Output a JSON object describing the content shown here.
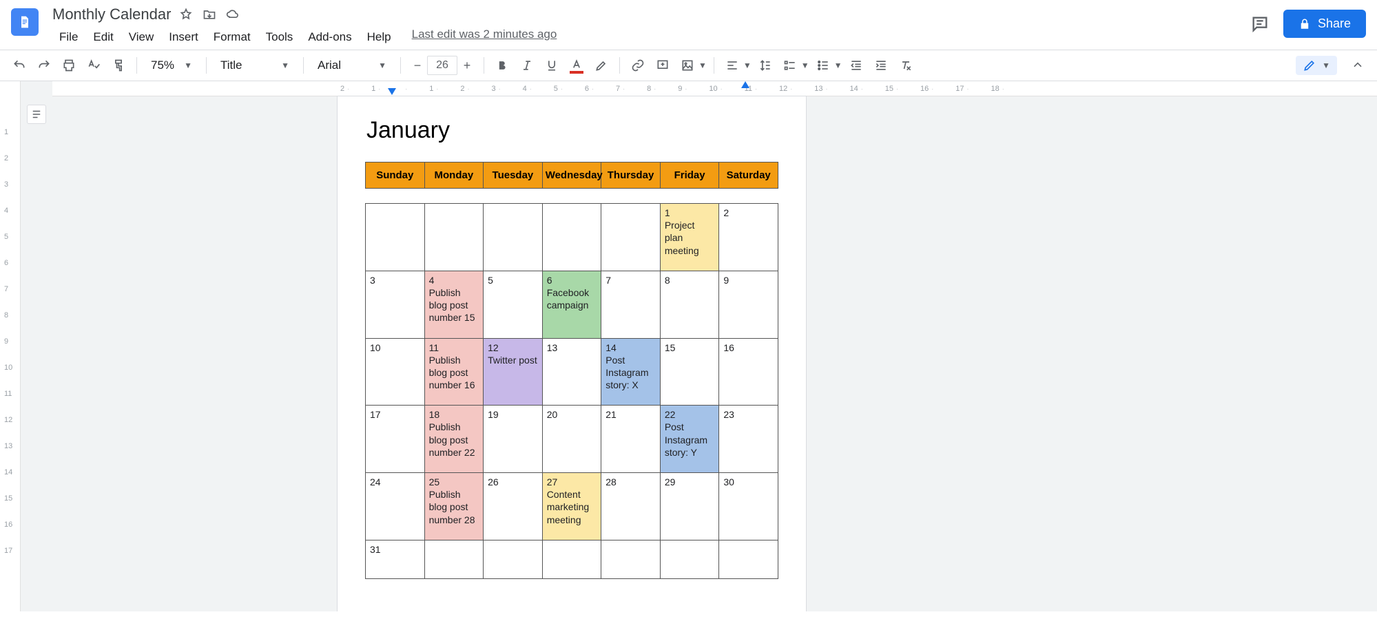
{
  "header": {
    "doc_title": "Monthly Calendar",
    "last_edit": "Last edit was 2 minutes ago",
    "share_label": "Share"
  },
  "menubar": [
    "File",
    "Edit",
    "View",
    "Insert",
    "Format",
    "Tools",
    "Add-ons",
    "Help"
  ],
  "toolbar": {
    "zoom": "75%",
    "styles": "Title",
    "font": "Arial",
    "font_size": "26"
  },
  "ruler": {
    "horizontal": [
      "2",
      "1",
      "",
      "1",
      "2",
      "3",
      "4",
      "5",
      "6",
      "7",
      "8",
      "9",
      "10",
      "11",
      "12",
      "13",
      "14",
      "15",
      "16",
      "17",
      "18"
    ],
    "vertical": [
      "",
      "1",
      "2",
      "3",
      "4",
      "5",
      "6",
      "7",
      "8",
      "9",
      "10",
      "11",
      "12",
      "13",
      "14",
      "15",
      "16",
      "17"
    ]
  },
  "doc": {
    "month_title": "January",
    "weekdays": [
      "Sunday",
      "Monday",
      "Tuesday",
      "Wednesday",
      "Thursday",
      "Friday",
      "Saturday"
    ],
    "rows": [
      [
        {
          "num": "",
          "event": "",
          "color": ""
        },
        {
          "num": "",
          "event": "",
          "color": ""
        },
        {
          "num": "",
          "event": "",
          "color": ""
        },
        {
          "num": "",
          "event": "",
          "color": ""
        },
        {
          "num": "",
          "event": "",
          "color": ""
        },
        {
          "num": "1",
          "event": "Project plan meeting",
          "color": "yellow"
        },
        {
          "num": "2",
          "event": "",
          "color": ""
        }
      ],
      [
        {
          "num": "3",
          "event": "",
          "color": ""
        },
        {
          "num": "4",
          "event": "Publish blog post number 15",
          "color": "pink"
        },
        {
          "num": "5",
          "event": "",
          "color": ""
        },
        {
          "num": "6",
          "event": "Facebook campaign",
          "color": "green"
        },
        {
          "num": "7",
          "event": "",
          "color": ""
        },
        {
          "num": "8",
          "event": "",
          "color": ""
        },
        {
          "num": "9",
          "event": "",
          "color": ""
        }
      ],
      [
        {
          "num": "10",
          "event": "",
          "color": ""
        },
        {
          "num": "11",
          "event": "Publish blog post number 16",
          "color": "pink"
        },
        {
          "num": "12",
          "event": "Twitter post",
          "color": "purple"
        },
        {
          "num": "13",
          "event": "",
          "color": ""
        },
        {
          "num": "14",
          "event": "Post Instagram story: X",
          "color": "blue"
        },
        {
          "num": "15",
          "event": "",
          "color": ""
        },
        {
          "num": "16",
          "event": "",
          "color": ""
        }
      ],
      [
        {
          "num": "17",
          "event": "",
          "color": ""
        },
        {
          "num": "18",
          "event": "Publish blog post number 22",
          "color": "pink"
        },
        {
          "num": "19",
          "event": "",
          "color": ""
        },
        {
          "num": "20",
          "event": "",
          "color": ""
        },
        {
          "num": "21",
          "event": "",
          "color": ""
        },
        {
          "num": "22",
          "event": "Post Instagram story: Y",
          "color": "blue"
        },
        {
          "num": "23",
          "event": "",
          "color": ""
        }
      ],
      [
        {
          "num": "24",
          "event": "",
          "color": ""
        },
        {
          "num": "25",
          "event": "Publish blog post number 28",
          "color": "pink"
        },
        {
          "num": "26",
          "event": "",
          "color": ""
        },
        {
          "num": "27",
          "event": "Content marketing meeting",
          "color": "yellow"
        },
        {
          "num": "28",
          "event": "",
          "color": ""
        },
        {
          "num": "29",
          "event": "",
          "color": ""
        },
        {
          "num": "30",
          "event": "",
          "color": ""
        }
      ],
      [
        {
          "num": "31",
          "event": "",
          "color": ""
        },
        {
          "num": "",
          "event": "",
          "color": ""
        },
        {
          "num": "",
          "event": "",
          "color": ""
        },
        {
          "num": "",
          "event": "",
          "color": ""
        },
        {
          "num": "",
          "event": "",
          "color": ""
        },
        {
          "num": "",
          "event": "",
          "color": ""
        },
        {
          "num": "",
          "event": "",
          "color": ""
        }
      ]
    ]
  }
}
